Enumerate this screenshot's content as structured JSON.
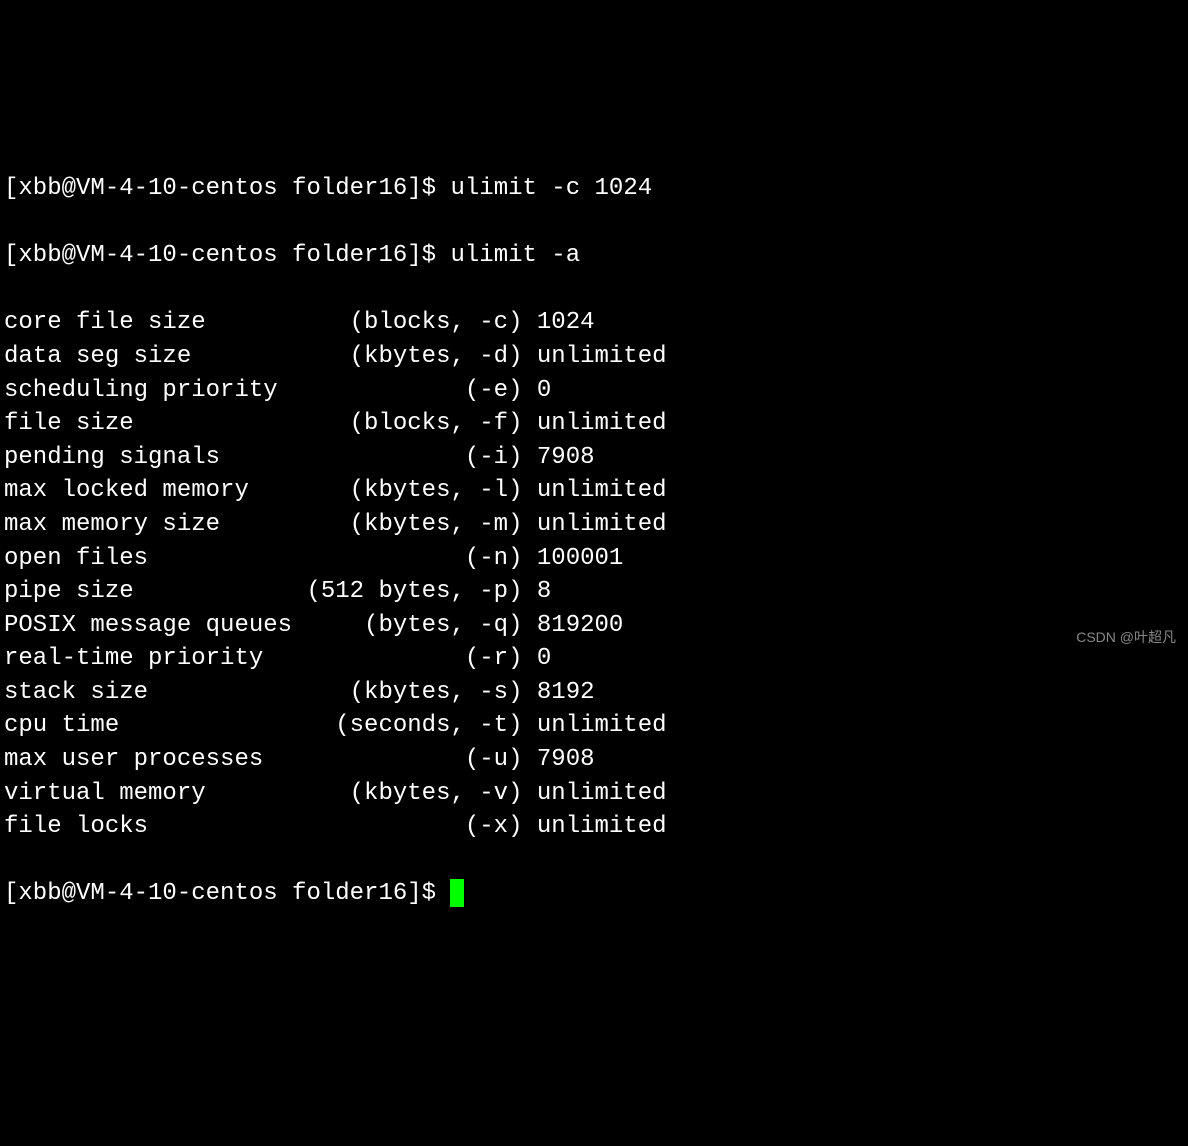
{
  "prompt": "[xbb@VM-4-10-centos folder16]$ ",
  "commands": {
    "cmd1": "ulimit -c 1024",
    "cmd2": "ulimit -a"
  },
  "ulimit_output": [
    {
      "label": "core file size          (blocks, -c)",
      "value": "1024"
    },
    {
      "label": "data seg size           (kbytes, -d)",
      "value": "unlimited"
    },
    {
      "label": "scheduling priority             (-e)",
      "value": "0"
    },
    {
      "label": "file size               (blocks, -f)",
      "value": "unlimited"
    },
    {
      "label": "pending signals                 (-i)",
      "value": "7908"
    },
    {
      "label": "max locked memory       (kbytes, -l)",
      "value": "unlimited"
    },
    {
      "label": "max memory size         (kbytes, -m)",
      "value": "unlimited"
    },
    {
      "label": "open files                      (-n)",
      "value": "100001"
    },
    {
      "label": "pipe size            (512 bytes, -p)",
      "value": "8"
    },
    {
      "label": "POSIX message queues     (bytes, -q)",
      "value": "819200"
    },
    {
      "label": "real-time priority              (-r)",
      "value": "0"
    },
    {
      "label": "stack size              (kbytes, -s)",
      "value": "8192"
    },
    {
      "label": "cpu time               (seconds, -t)",
      "value": "unlimited"
    },
    {
      "label": "max user processes              (-u)",
      "value": "7908"
    },
    {
      "label": "virtual memory          (kbytes, -v)",
      "value": "unlimited"
    },
    {
      "label": "file locks                      (-x)",
      "value": "unlimited"
    }
  ],
  "watermark": "CSDN @叶超凡"
}
